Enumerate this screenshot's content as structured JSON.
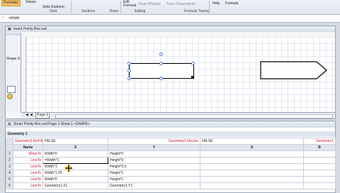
{
  "ribbon": {
    "tabs": [
      "Formulas",
      "Values",
      "Style Explorer"
    ],
    "group_labels": [
      "View",
      "Sections",
      "Rows",
      "Editing",
      "Formula Tracing"
    ],
    "edit_formula": "Edit Formula",
    "show_window": "Show Window",
    "trace_dependents": "Trace Dependents",
    "help_label": "Help",
    "formula_label": "Formula"
  },
  "formula_bar": {
    "value": "=Width"
  },
  "drawing_window": {
    "title": "Insert Pointy Box.vsd",
    "stencil_label": "Shape D",
    "page_tab": "Page-1"
  },
  "shapesheet": {
    "title": "Smart Pointy Box.vsd:Page-1:Sheet.1 <SHAPE>",
    "section_title": "Geometry 1",
    "row_geometry": [
      {
        "label": "Geometry1.NoFill",
        "value": "FALSE"
      },
      {
        "label": "Geometry1.NoLine",
        "value": "FALSE"
      },
      {
        "label": "Geometry1",
        "value": ""
      }
    ],
    "columns": [
      "Name",
      "X",
      "Y",
      "A",
      "B"
    ],
    "rows": [
      {
        "n": "1",
        "name": "MoveTo",
        "x": "Width*0",
        "y": "Height*0"
      },
      {
        "n": "2",
        "name": "LineTo",
        "x": "=Width*1",
        "y": "Height*0"
      },
      {
        "n": "3",
        "name": "LineTo",
        "x": "Width*1",
        "y": "Height*0.5"
      },
      {
        "n": "4",
        "name": "LineTo",
        "x": "Width*1.25",
        "y": "Height*1"
      },
      {
        "n": "5",
        "name": "LineTo",
        "x": "Width*0",
        "y": "Height*1"
      },
      {
        "n": "6",
        "name": "LineTo",
        "x": "Geometry1.X1",
        "y": "Geometry1.Y1"
      }
    ]
  }
}
